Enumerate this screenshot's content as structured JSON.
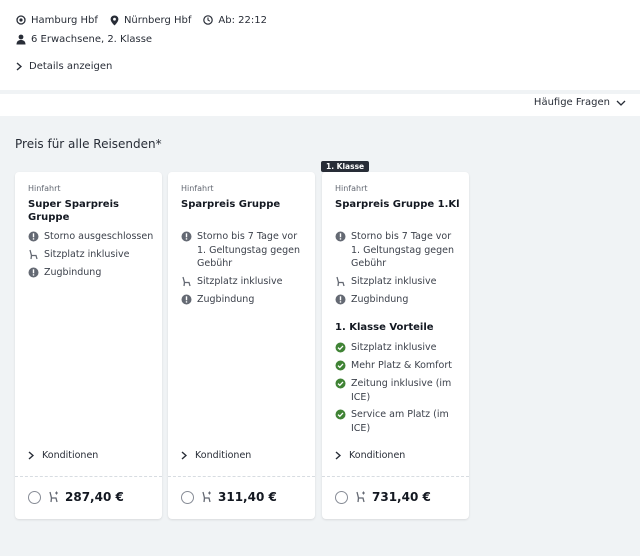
{
  "journey": {
    "from": "Hamburg Hbf",
    "to": "Nürnberg Hbf",
    "departure": "Ab: 22:12",
    "travelers": "6 Erwachsene, 2. Klasse",
    "details_link": "Details anzeigen"
  },
  "faq_label": "Häufige Fragen",
  "section_heading": "Preis für alle Reisenden*",
  "badge": "1. Klasse",
  "cards": [
    {
      "direction": "Hinfahrt",
      "name": "Super Sparpreis Gruppe",
      "features": [
        {
          "icon": "info-icon",
          "text": "Storno ausgeschlossen"
        },
        {
          "icon": "seat-icon",
          "text": "Sitzplatz inklusive"
        },
        {
          "icon": "info-icon",
          "text": "Zugbindung"
        }
      ],
      "conditions": "Konditionen",
      "price": "287,40 €"
    },
    {
      "direction": "Hinfahrt",
      "name": "Sparpreis Gruppe",
      "features": [
        {
          "icon": "info-icon",
          "text": "Storno bis 7 Tage vor 1. Geltungstag gegen Gebühr"
        },
        {
          "icon": "seat-icon",
          "text": "Sitzplatz inklusive"
        },
        {
          "icon": "info-icon",
          "text": "Zugbindung"
        }
      ],
      "conditions": "Konditionen",
      "price": "311,40 €"
    },
    {
      "direction": "Hinfahrt",
      "name": "Sparpreis Gruppe 1.Kl",
      "features": [
        {
          "icon": "info-icon",
          "text": "Storno bis 7 Tage vor 1. Geltungstag gegen Gebühr"
        },
        {
          "icon": "seat-icon",
          "text": "Sitzplatz inklusive"
        },
        {
          "icon": "info-icon",
          "text": "Zugbindung"
        }
      ],
      "benefits_title": "1. Klasse Vorteile",
      "benefits": [
        {
          "icon": "check-icon",
          "text": "Sitzplatz inklusive"
        },
        {
          "icon": "check-icon",
          "text": "Mehr Platz & Komfort"
        },
        {
          "icon": "check-icon",
          "text": "Zeitung inklusive (im ICE)"
        },
        {
          "icon": "check-icon",
          "text": "Service am Platz (im ICE)"
        }
      ],
      "conditions": "Konditionen",
      "price": "731,40 €"
    }
  ],
  "colors": {
    "check": "#408335",
    "info": "#646973",
    "background": "#f0f3f5"
  }
}
